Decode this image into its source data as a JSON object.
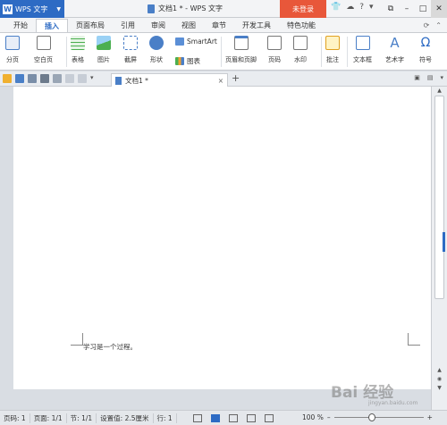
{
  "titlebar": {
    "app_label": "WPS 文字",
    "doc_title": "文档1 * - WPS 文字",
    "login_label": "未登录"
  },
  "menu": {
    "tabs": [
      "开始",
      "插入",
      "页面布局",
      "引用",
      "审阅",
      "视图",
      "章节",
      "开发工具",
      "特色功能"
    ],
    "active_tab": "插入"
  },
  "ribbon": {
    "page_break": "分页",
    "blank_page": "空白页",
    "table": "表格",
    "picture": "图片",
    "screenshot": "截屏",
    "shape": "形状",
    "smartart": "SmartArt",
    "chart": "图表",
    "header_footer": "页眉和页脚",
    "page_number": "页码",
    "watermark": "水印",
    "comment": "批注",
    "textbox": "文本框",
    "wordart": "艺术字",
    "symbol": "符号"
  },
  "doctab": {
    "name": "文档1 *"
  },
  "document": {
    "body_text": "学习是一个过程。"
  },
  "status": {
    "line": "页码: 1",
    "page": "页面: 1/1",
    "section": "节: 1/1",
    "setting": "设置值: 2.5厘米",
    "row": "行: 1",
    "zoom_label": "100 %",
    "zoom_percent": 100
  },
  "watermark_text": "Bai 经验",
  "watermark_sub": "jingyan.baidu.com",
  "colors": {
    "accent": "#2d6bc4",
    "login": "#e8573a"
  }
}
